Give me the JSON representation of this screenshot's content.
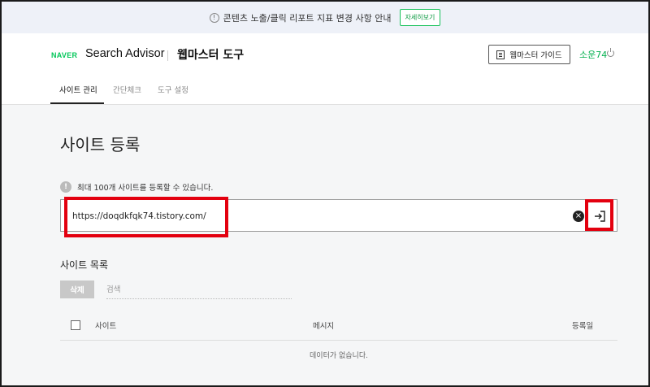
{
  "notice": {
    "text": "콘텐츠 노출/클릭 리포트 지표 변경 사항 안내",
    "detail_label": "자세히보기"
  },
  "header": {
    "brand": "NAVER",
    "product": "Search Advisor",
    "tool": "웹마스터 도구",
    "guide_label": "웹마스터 가이드",
    "user_name": "소운74"
  },
  "tabs": [
    {
      "label": "사이트 관리",
      "active": true
    },
    {
      "label": "간단체크",
      "active": false
    },
    {
      "label": "도구 설정",
      "active": false
    }
  ],
  "main": {
    "title": "사이트 등록",
    "limit_note": "최대 100개 사이트를 등록할 수 있습니다.",
    "url_value": "https://doqdkfqk74.tistory.com/"
  },
  "list": {
    "title": "사이트 목록",
    "delete_label": "삭제",
    "search_placeholder": "검색",
    "columns": [
      "사이트",
      "메시지",
      "등록일"
    ],
    "empty_message": "데이터가 없습니다."
  },
  "colors": {
    "accent": "#03c75a",
    "highlight": "#e3000f"
  }
}
